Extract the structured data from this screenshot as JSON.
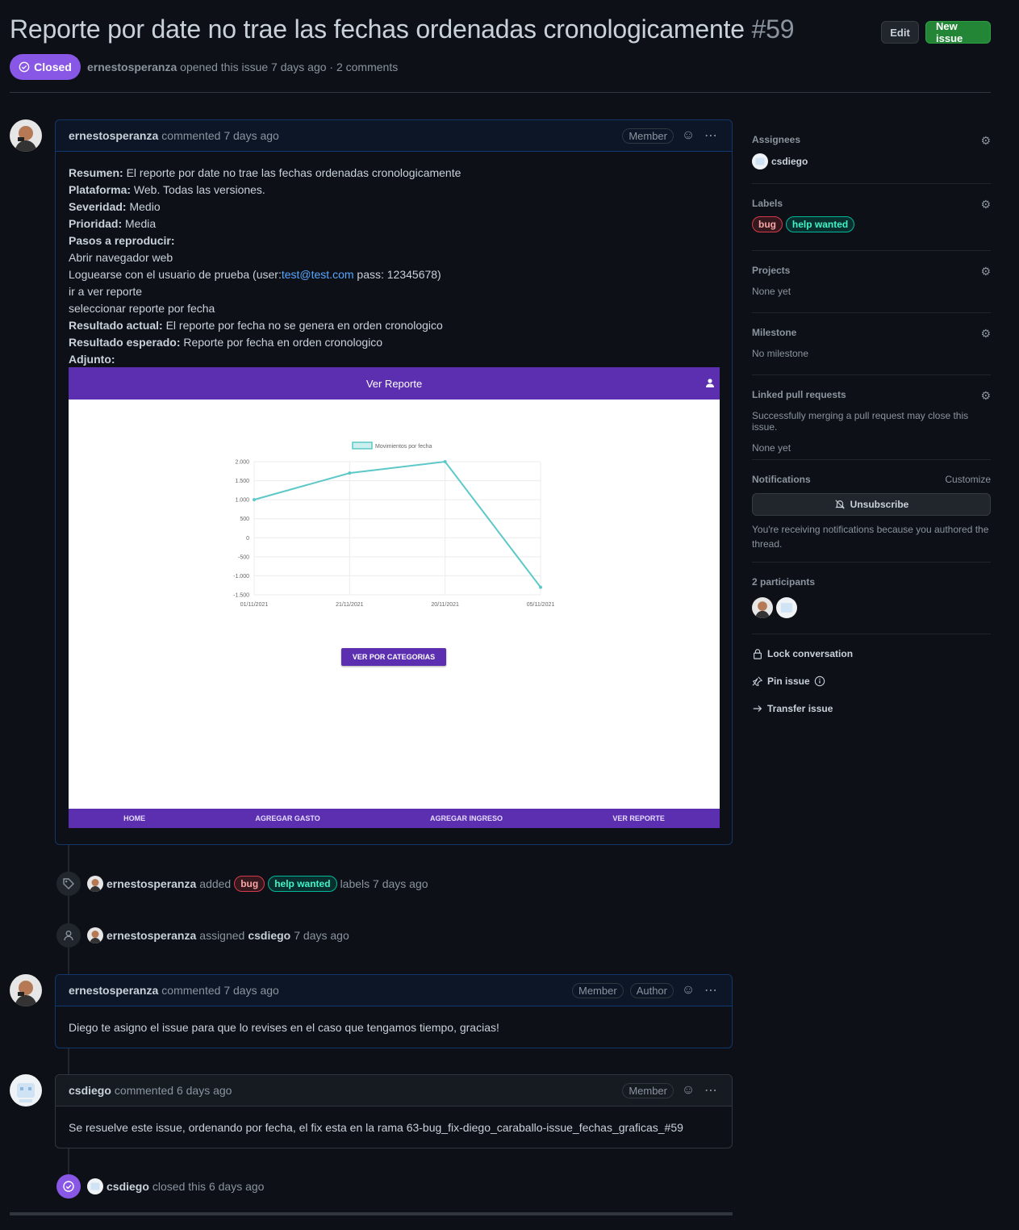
{
  "header": {
    "title": "Reporte por date no trae las fechas ordenadas cronologicamente",
    "number": "#59",
    "edit_label": "Edit",
    "new_issue_label": "New issue",
    "state": "Closed",
    "author": "ernestosperanza",
    "meta_text": "opened this issue 7 days ago · 2 comments"
  },
  "comment1": {
    "author": "ernestosperanza",
    "time": "commented 7 days ago",
    "badge": "Member",
    "lines": [
      {
        "k": "Resumen:",
        "v": " El reporte por date no trae las fechas ordenadas cronologicamente"
      },
      {
        "k": "Plataforma:",
        "v": " Web. Todas las versiones."
      },
      {
        "k": "Severidad:",
        "v": " Medio"
      },
      {
        "k": "Prioridad:",
        "v": " Media"
      },
      {
        "k": "Pasos a reproducir:",
        "v": ""
      }
    ],
    "step1": "Abrir navegador web",
    "step2_pre": "Loguearse con el usuario de prueba (user:",
    "step2_link": "test@test.com",
    "step2_post": " pass: 12345678)",
    "step3": "ir a ver reporte",
    "step4": "seleccionar reporte por fecha",
    "actual_k": "Resultado actual:",
    "actual_v": " El reporte por fecha no se genera en orden cronologico",
    "expected_k": "Resultado esperado:",
    "expected_v": " Reporte por fecha en orden cronologico",
    "attach_k": "Adjunto:"
  },
  "screenshot": {
    "title": "Ver Reporte",
    "legend": "Movimientos por fecha",
    "button": "VER POR CATEGORIAS",
    "nav": [
      "HOME",
      "AGREGAR GASTO",
      "AGREGAR INGRESO",
      "VER REPORTE"
    ]
  },
  "chart_data": {
    "type": "line",
    "categories": [
      "01/11/2021",
      "21/11/2021",
      "20/11/2021",
      "05/11/2021"
    ],
    "series": [
      {
        "name": "Movimientos por fecha",
        "values": [
          1000,
          1700,
          2000,
          -1300
        ]
      }
    ],
    "yticks": [
      "2.000",
      "1.500",
      "1.000",
      "500",
      "0",
      "-500",
      "-1.000",
      "-1.500"
    ],
    "ylim": [
      -1500,
      2000
    ],
    "grid": true,
    "legend": "top",
    "color": "#5cc8c8"
  },
  "events": {
    "labels_actor": "ernestosperanza",
    "labels_added": "added",
    "labels_suffix": "labels 7 days ago",
    "assign_actor": "ernestosperanza",
    "assign_verb": "assigned",
    "assign_target": "csdiego",
    "assign_time": "7 days ago",
    "closed_actor": "csdiego",
    "closed_text": "closed this 6 days ago"
  },
  "comment2": {
    "author": "ernestosperanza",
    "time": "commented 7 days ago",
    "badge1": "Member",
    "badge2": "Author",
    "body": "Diego te asigno el issue para que lo revises en el caso que tengamos tiempo, gracias!"
  },
  "comment3": {
    "author": "csdiego",
    "time": "commented 6 days ago",
    "badge": "Member",
    "body": "Se resuelve este issue, ordenando por fecha, el fix esta en la rama 63-bug_fix-diego_caraballo-issue_fechas_graficas_#59"
  },
  "labels": {
    "bug": "bug",
    "help": "help wanted"
  },
  "sidebar": {
    "assignees_title": "Assignees",
    "assignee": "csdiego",
    "labels_title": "Labels",
    "projects_title": "Projects",
    "projects_value": "None yet",
    "milestone_title": "Milestone",
    "milestone_value": "No milestone",
    "linked_title": "Linked pull requests",
    "linked_desc": "Successfully merging a pull request may close this issue.",
    "linked_value": "None yet",
    "notifications_title": "Notifications",
    "customize": "Customize",
    "unsubscribe": "Unsubscribe",
    "notif_desc": "You're receiving notifications because you authored the thread.",
    "participants_title": "2 participants",
    "lock": "Lock conversation",
    "pin": "Pin issue",
    "transfer": "Transfer issue"
  }
}
